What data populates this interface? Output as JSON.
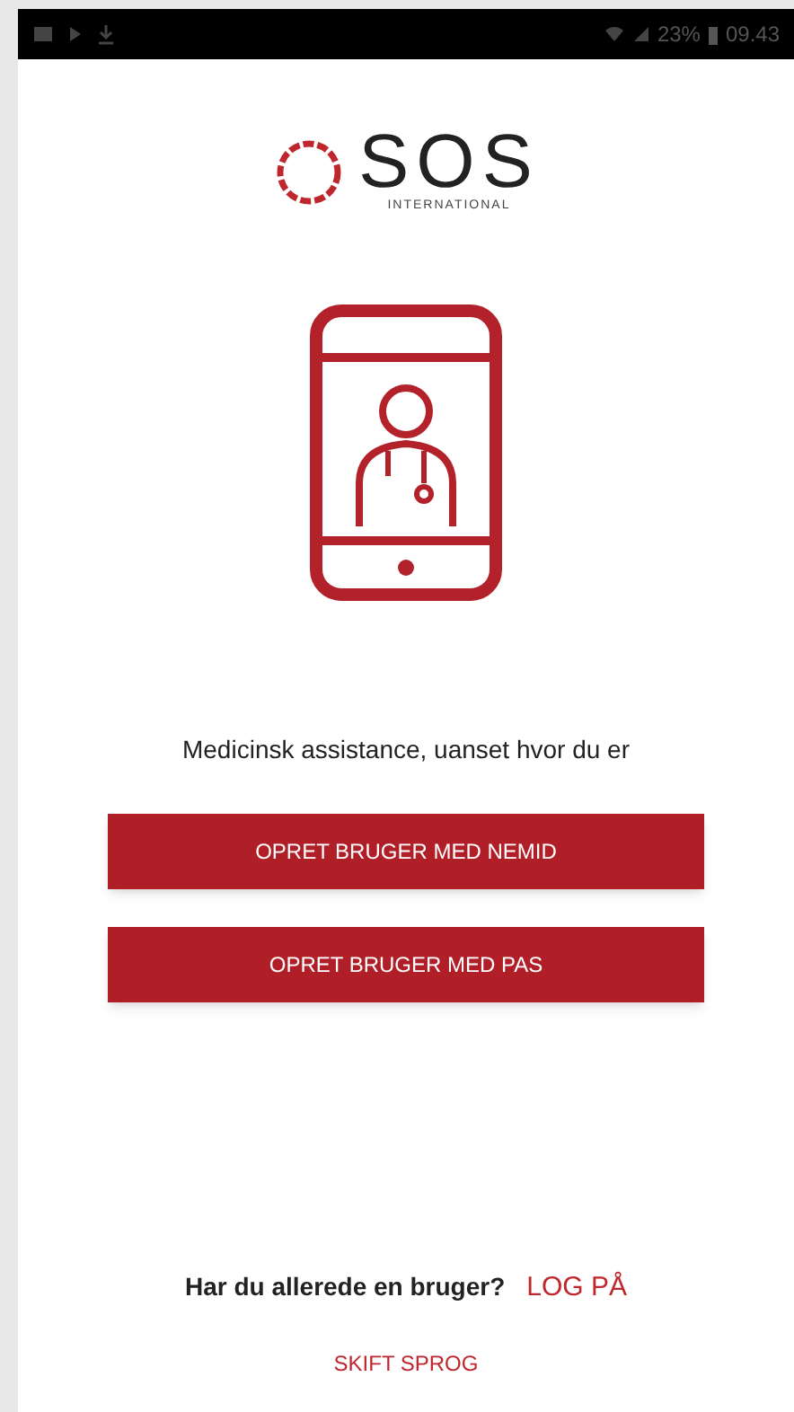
{
  "status_bar": {
    "battery": "23%",
    "time": "09.43"
  },
  "logo": {
    "name": "SOS",
    "subtitle": "INTERNATIONAL"
  },
  "tagline": "Medicinsk assistance, uanset hvor du er",
  "buttons": [
    "OPRET BRUGER MED NEMID",
    "OPRET BRUGER MED PAS"
  ],
  "login": {
    "question": "Har du allerede en bruger?",
    "link": "LOG PÅ"
  },
  "language_link": "SKIFT SPROG"
}
